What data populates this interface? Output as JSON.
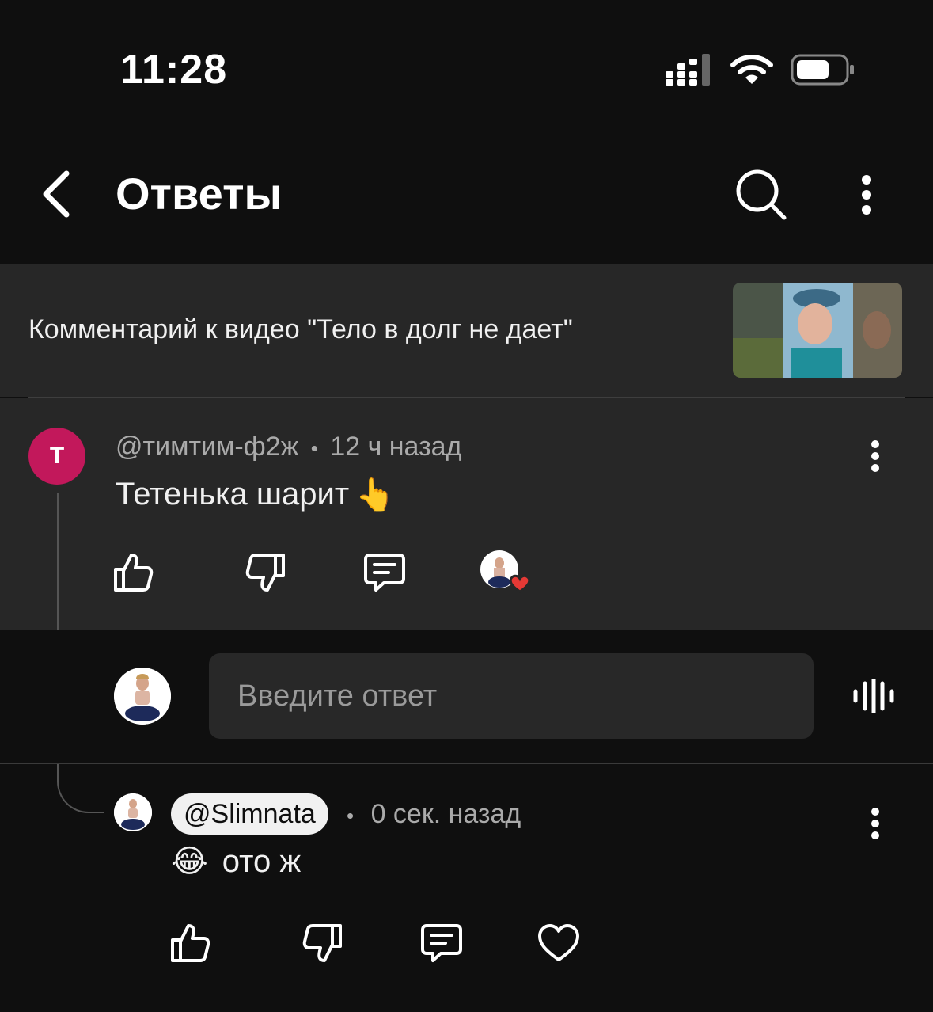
{
  "status_bar": {
    "time": "11:28"
  },
  "header": {
    "title": "Ответы"
  },
  "video_context": {
    "text": "Комментарий к видео \"Тело в долг не дает\""
  },
  "parent_comment": {
    "avatar_letter": "Т",
    "author": "@тимтим-ф2ж",
    "separator": "•",
    "time": "12 ч назад",
    "text": "Тетенька шарит",
    "emoji": "👆"
  },
  "reply_input": {
    "placeholder": "Введите ответ"
  },
  "reply": {
    "author": "@Slimnata",
    "separator": "•",
    "time": "0 сек. назад",
    "emoji": "😂",
    "text": "ото ж"
  },
  "colors": {
    "background": "#0f0f0f",
    "panel": "#272727",
    "avatar_accent": "#c2185b",
    "heart": "#e53935"
  }
}
